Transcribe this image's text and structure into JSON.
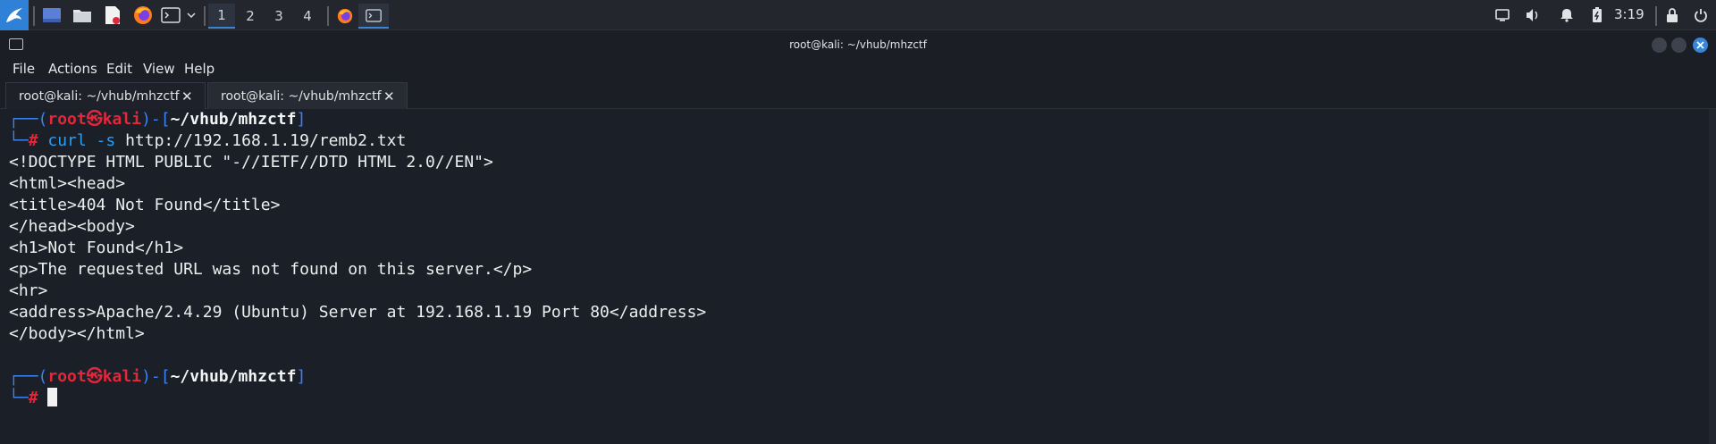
{
  "panel": {
    "workspaces": [
      "1",
      "2",
      "3",
      "4"
    ],
    "active_workspace": "1",
    "clock": "3:19",
    "accent": "#2f80d7"
  },
  "window": {
    "title": "root@kali: ~/vhub/mhzctf"
  },
  "menubar": {
    "items": [
      "File",
      "Actions",
      "Edit",
      "View",
      "Help"
    ]
  },
  "tabs": [
    {
      "label": "root@kali: ~/vhub/mhzctf",
      "active": false
    },
    {
      "label": "root@kali: ~/vhub/mhzctf",
      "active": true
    }
  ],
  "terminal": {
    "prompt1": {
      "open": "┌──(",
      "user": "root",
      "skull": "㉿",
      "host": "kali",
      "mid": ")-[",
      "path": "~/vhub/mhzctf",
      "close": "]"
    },
    "prompt1_line2": {
      "corner": "└─",
      "hash": "#",
      "command": "curl -s",
      "args": "http://192.168.1.19/remb2.txt"
    },
    "output": [
      "<!DOCTYPE HTML PUBLIC \"-//IETF//DTD HTML 2.0//EN\">",
      "<html><head>",
      "<title>404 Not Found</title>",
      "</head><body>",
      "<h1>Not Found</h1>",
      "<p>The requested URL was not found on this server.</p>",
      "<hr>",
      "<address>Apache/2.4.29 (Ubuntu) Server at 192.168.1.19 Port 80</address>",
      "</body></html>"
    ],
    "prompt2": {
      "open": "┌──(",
      "user": "root",
      "skull": "㉿",
      "host": "kali",
      "mid": ")-[",
      "path": "~/vhub/mhzctf",
      "close": "]"
    },
    "prompt2_line2": {
      "corner": "└─",
      "hash": "#"
    },
    "colors": {
      "prompt_frame": "#3b82f6",
      "user_host": "#e0283a",
      "command": "#2d9cf3",
      "background": "#1b1f27"
    }
  }
}
